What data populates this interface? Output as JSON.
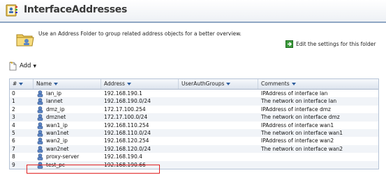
{
  "header": {
    "title": "InterfaceAddresses"
  },
  "description": {
    "text": "Use an Address Folder to group related address objects for a better overview.",
    "edit_link": "Edit the settings for this folder"
  },
  "toolbar": {
    "add_label": "Add"
  },
  "table": {
    "columns": [
      "#",
      "Name",
      "Address",
      "UserAuthGroups",
      "Comments"
    ],
    "rows": [
      {
        "idx": "0",
        "name": "lan_ip",
        "address": "192.168.190.1",
        "uag": "",
        "comment": "IPAddress of interface lan"
      },
      {
        "idx": "1",
        "name": "lannet",
        "address": "192.168.190.0/24",
        "uag": "",
        "comment": "The network on interface lan"
      },
      {
        "idx": "2",
        "name": "dmz_ip",
        "address": "172.17.100.254",
        "uag": "",
        "comment": "IPAddress of interface dmz"
      },
      {
        "idx": "3",
        "name": "dmznet",
        "address": "172.17.100.0/24",
        "uag": "",
        "comment": "The network on interface dmz"
      },
      {
        "idx": "4",
        "name": "wan1_ip",
        "address": "192.168.110.254",
        "uag": "",
        "comment": "IPAddress of interface wan1"
      },
      {
        "idx": "5",
        "name": "wan1net",
        "address": "192.168.110.0/24",
        "uag": "",
        "comment": "The network on interface wan1"
      },
      {
        "idx": "6",
        "name": "wan2_ip",
        "address": "192.168.120.254",
        "uag": "",
        "comment": "IPAddress of interface wan2"
      },
      {
        "idx": "7",
        "name": "wan2net",
        "address": "192.168.120.0/24",
        "uag": "",
        "comment": "The network on interface wan2"
      },
      {
        "idx": "8",
        "name": "proxy-server",
        "address": "192.168.190.4",
        "uag": "",
        "comment": ""
      },
      {
        "idx": "9",
        "name": "test_pc",
        "address": "192.168.190.66",
        "uag": "",
        "comment": ""
      }
    ]
  },
  "colors": {
    "highlight": "#e02020",
    "header_border": "#8fa6c4",
    "sort_arrow": "#2e5e9e"
  },
  "icons": [
    "address-book-icon",
    "folder-icon",
    "edit-settings-icon",
    "add-document-icon",
    "address-object-icon"
  ]
}
